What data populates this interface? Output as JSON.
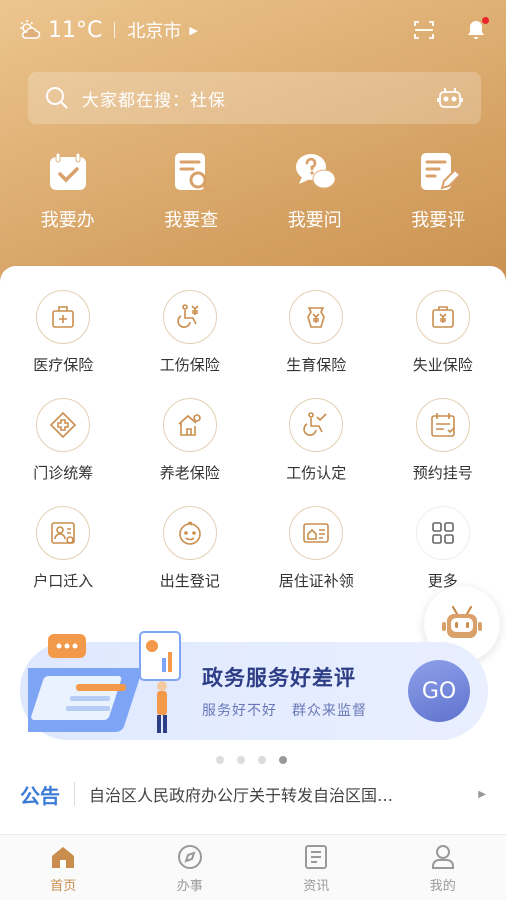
{
  "status": {
    "temperature": "11°C",
    "city": "北京市"
  },
  "search": {
    "placeholder": "大家都在搜：社保"
  },
  "top_actions": [
    {
      "label": "我要办",
      "icon": "calendar-check-icon"
    },
    {
      "label": "我要查",
      "icon": "document-search-icon"
    },
    {
      "label": "我要问",
      "icon": "question-chat-icon"
    },
    {
      "label": "我要评",
      "icon": "document-edit-icon"
    }
  ],
  "services": [
    {
      "label": "医疗保险",
      "icon": "medical-kit-icon"
    },
    {
      "label": "工伤保险",
      "icon": "wheelchair-yen-icon"
    },
    {
      "label": "生育保险",
      "icon": "bottle-yen-icon"
    },
    {
      "label": "失业保险",
      "icon": "briefcase-yen-icon"
    },
    {
      "label": "门诊统筹",
      "icon": "clinic-cross-icon"
    },
    {
      "label": "养老保险",
      "icon": "home-person-icon"
    },
    {
      "label": "工伤认定",
      "icon": "wheelchair-check-icon"
    },
    {
      "label": "预约挂号",
      "icon": "calendar-list-icon"
    },
    {
      "label": "户口迁入",
      "icon": "id-card-icon"
    },
    {
      "label": "出生登记",
      "icon": "baby-face-icon"
    },
    {
      "label": "居住证补领",
      "icon": "residence-card-icon"
    },
    {
      "label": "更多",
      "icon": "grid-more-icon"
    }
  ],
  "banner": {
    "title": "政务服务好差评",
    "subtitle": "服务好不好　群众来监督",
    "go_label": "GO"
  },
  "notice": {
    "tag": "公告",
    "text": "自治区人民政府办公厅关于转发自治区国…"
  },
  "tabs": [
    {
      "label": "首页",
      "icon": "home-icon",
      "active": true
    },
    {
      "label": "办事",
      "icon": "compass-icon",
      "active": false
    },
    {
      "label": "资讯",
      "icon": "news-icon",
      "active": false
    },
    {
      "label": "我的",
      "icon": "user-icon",
      "active": false
    }
  ],
  "colors": {
    "accent": "#c98d4e",
    "header": "#d9a76a",
    "notice": "#3a7bd5",
    "banner_title": "#2d3e86"
  }
}
